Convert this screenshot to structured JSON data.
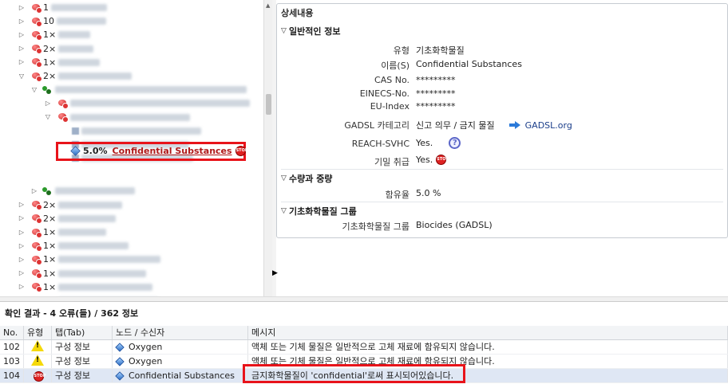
{
  "tree": {
    "rows": [
      {
        "toggle": "▷",
        "icon": "substance",
        "count": "1",
        "blur": 70
      },
      {
        "toggle": "▷",
        "icon": "substance",
        "count": "10",
        "blur": 62
      },
      {
        "toggle": "▷",
        "icon": "substance",
        "count": "1×",
        "blur": 40
      },
      {
        "toggle": "▷",
        "icon": "substance",
        "count": "2×",
        "blur": 44
      },
      {
        "toggle": "▷",
        "icon": "substance",
        "count": "1×",
        "blur": 52
      },
      {
        "toggle": "▽",
        "icon": "substance",
        "count": "2×",
        "blur": 92
      },
      {
        "toggle": "▽",
        "icon": "molecule",
        "count": "",
        "blur": 240
      },
      {
        "toggle": "▷",
        "icon": "substance",
        "count": "",
        "blur": 230
      },
      {
        "toggle": "▽",
        "icon": "substance",
        "count": "",
        "blur": 150
      },
      {
        "toggle": "",
        "icon": "square",
        "count": "",
        "blur": 150
      },
      {
        "toggle": "",
        "icon": "square",
        "count": "",
        "blur": 135
      },
      {
        "toggle": "",
        "icon": "square",
        "count": "",
        "blur": 140
      },
      {
        "toggle": "▷",
        "icon": "molecule",
        "count": "",
        "blur": 100
      },
      {
        "toggle": "▷",
        "icon": "substance",
        "count": "2×",
        "blur": 80
      },
      {
        "toggle": "▷",
        "icon": "substance",
        "count": "2×",
        "blur": 72
      },
      {
        "toggle": "▷",
        "icon": "substance",
        "count": "1×",
        "blur": 60
      },
      {
        "toggle": "▷",
        "icon": "substance",
        "count": "1×",
        "blur": 88
      },
      {
        "toggle": "▷",
        "icon": "substance",
        "count": "1×",
        "blur": 128
      },
      {
        "toggle": "▷",
        "icon": "substance",
        "count": "1×",
        "blur": 110
      },
      {
        "toggle": "▷",
        "icon": "substance",
        "count": "1×",
        "blur": 118
      },
      {
        "toggle": "▷",
        "icon": "substance",
        "count": "1×",
        "blur": 126
      },
      {
        "toggle": "▷",
        "icon": "substance",
        "count": "1×",
        "blur": 130
      },
      {
        "toggle": "▷",
        "icon": "substance",
        "count": "1×",
        "blur": 145
      }
    ],
    "highlighted": {
      "percent": "5.0%",
      "name": "Confidential Substances",
      "stop_label": "STOP"
    }
  },
  "detail": {
    "title": "상세내용",
    "sections": {
      "general": "일반적인 정보",
      "amount": "수량과 중량",
      "group": "기초화학물질 그룹"
    },
    "fields": {
      "type_label": "유형",
      "type_value": "기초화학물질",
      "name_label": "이름(S)",
      "name_value": "Confidential Substances",
      "cas_label": "CAS No.",
      "cas_value": "*********",
      "einecs_label": "EINECS-No.",
      "einecs_value": "*********",
      "euindex_label": "EU-Index",
      "euindex_value": "*********",
      "gadsl_label": "GADSL 카테고리",
      "gadsl_value": "신고 의무 / 금지 물질",
      "gadsl_link": "GADSL.org",
      "reach_label": "REACH-SVHC",
      "reach_value": "Yes.",
      "help_icon": "?",
      "secret_label": "기밀 취급",
      "secret_value": "Yes.",
      "stop_label": "STOP",
      "content_label": "함유율",
      "content_value": "5.0 %",
      "group_label": "기초화학물질 그룹",
      "group_value": "Biocides (GADSL)"
    }
  },
  "results": {
    "title": "확인 결과 - 4 오류(들) / 362 정보",
    "columns": [
      "No.",
      "유형",
      "탭(Tab)",
      "노드 / 수신자",
      "메시지"
    ],
    "rows": [
      {
        "no": "102",
        "type": "warning",
        "tab": "구성 정보",
        "node": "Oxygen",
        "message": "액체 또는 기체 물질은 일반적으로 고체 재료에 함유되지 않습니다."
      },
      {
        "no": "103",
        "type": "warning",
        "tab": "구성 정보",
        "node": "Oxygen",
        "message": "액체 또는 기체 물질은 일반적으로 고체 재료에 함유되지 않습니다."
      },
      {
        "no": "104",
        "type": "stop",
        "tab": "구성 정보",
        "node": "Confidential Substances",
        "message": "금지화학물질이 'confidential'로써 표시되어있습니다."
      }
    ],
    "stop_label": "STOP"
  }
}
